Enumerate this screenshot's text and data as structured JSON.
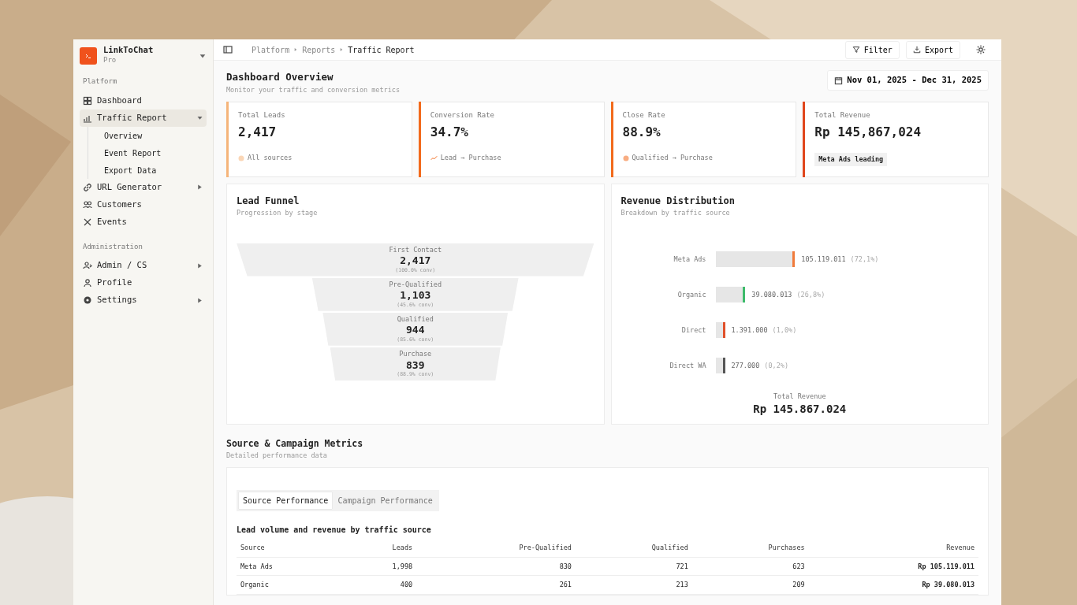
{
  "brand": {
    "name": "LinkToChat",
    "plan": "Pro"
  },
  "sidebar": [
    {
      "heading": "Platform",
      "items": [
        {
          "label": "Dashboard",
          "selected": false
        },
        {
          "label": "Traffic Report",
          "selected": true,
          "expanded": true,
          "children": [
            {
              "label": "Overview"
            },
            {
              "label": "Event Report"
            },
            {
              "label": "Export Data"
            }
          ]
        },
        {
          "label": "URL Generator",
          "selected": false,
          "expanded": false
        },
        {
          "label": "Customers",
          "selected": false
        },
        {
          "label": "Events",
          "selected": false
        }
      ]
    },
    {
      "heading": "Administration",
      "items": [
        {
          "label": "Admin / CS",
          "selected": false,
          "expanded": false
        },
        {
          "label": "Profile",
          "selected": false
        },
        {
          "label": "Settings",
          "selected": false,
          "expanded": false
        }
      ]
    }
  ],
  "breadcrumb": [
    "Platform",
    "Reports",
    "Traffic Report"
  ],
  "toolbar": [
    "Filter",
    "Export"
  ],
  "page": {
    "title": "Dashboard Overview",
    "subtitle": "Monitor your traffic and conversion metrics",
    "date_range": "Nov 01, 2025 - Dec 31, 2025"
  },
  "stats": [
    {
      "label": "Total Leads",
      "value": "2,417",
      "note": "All sources",
      "kind": "dot",
      "color": "#f5b47a"
    },
    {
      "label": "Conversion Rate",
      "value": "34.7%",
      "note": "Lead → Purchase",
      "kind": "trend",
      "color": "#f26a1b"
    },
    {
      "label": "Close Rate",
      "value": "88.9%",
      "note": "Qualified → Purchase",
      "kind": "dot",
      "color": "#f26a1b"
    },
    {
      "label": "Total Revenue",
      "value": "Rp 145,867,024",
      "note": "Meta Ads leading",
      "kind": "badge",
      "color": "#e0461c"
    }
  ],
  "funnel": {
    "title": "Lead Funnel",
    "subtitle": "Progression by stage",
    "stages": [
      {
        "label": "First Contact",
        "value": "2,417",
        "conv": "(100.0% conv)"
      },
      {
        "label": "Pre-Qualified",
        "value": "1,103",
        "conv": "(45.6% conv)"
      },
      {
        "label": "Qualified",
        "value": "944",
        "conv": "(85.6% conv)"
      },
      {
        "label": "Purchase",
        "value": "839",
        "conv": "(88.9% conv)"
      }
    ]
  },
  "revenue": {
    "title": "Revenue Distribution",
    "subtitle": "Breakdown by traffic source",
    "total_label": "Total Revenue",
    "total": "Rp 145.867.024",
    "sources": [
      {
        "label": "Meta Ads",
        "amount": "105.119.011",
        "share": "(72,1%)",
        "level": 0.72,
        "color": "#f07a3a"
      },
      {
        "label": "Organic",
        "amount": "39.080.013",
        "share": "(26,8%)",
        "level": 0.27,
        "color": "#3dbb6b"
      },
      {
        "label": "Direct",
        "amount": "1.391.000",
        "share": "(1,0%)",
        "level": 0.03,
        "color": "#e0502a"
      },
      {
        "label": "Direct WA",
        "amount": "277.000",
        "share": "(0,2%)",
        "level": 0.01,
        "color": "#555555"
      }
    ]
  },
  "metrics": {
    "title": "Source & Campaign Metrics",
    "subtitle": "Detailed performance data",
    "tabs": [
      {
        "label": "Source Performance",
        "selected": true
      },
      {
        "label": "Campaign Performance",
        "selected": false
      }
    ],
    "caption": "Lead volume and revenue by traffic source",
    "columns": [
      "Source",
      "Leads",
      "Pre-Qualified",
      "Qualified",
      "Purchases",
      "Revenue"
    ],
    "rows": [
      [
        "Meta Ads",
        "1,998",
        "830",
        "721",
        "623",
        "Rp 105.119.011"
      ],
      [
        "Organic",
        "400",
        "261",
        "213",
        "209",
        "Rp 39.080.013"
      ]
    ]
  }
}
